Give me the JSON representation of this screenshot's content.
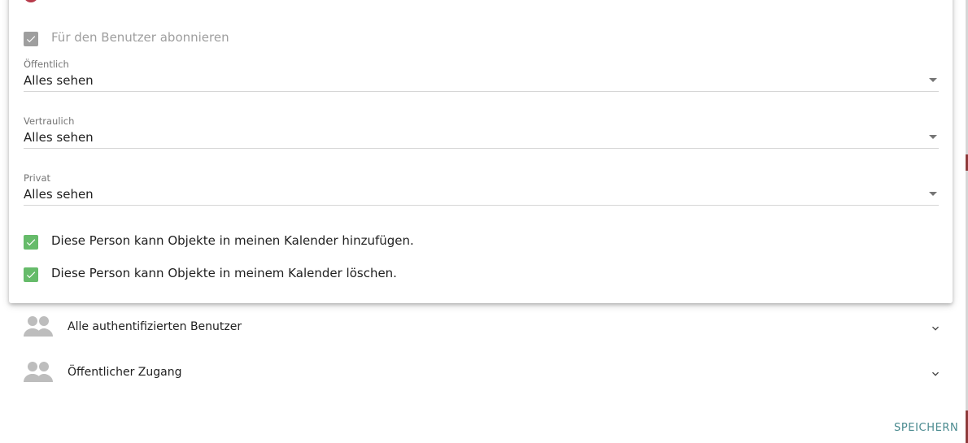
{
  "subscribe": {
    "label": "Für den Benutzer abonnieren",
    "checked": true,
    "disabled": true
  },
  "fields": [
    {
      "label": "Öffentlich",
      "value": "Alles sehen"
    },
    {
      "label": "Vertraulich",
      "value": "Alles sehen"
    },
    {
      "label": "Privat",
      "value": "Alles sehen"
    }
  ],
  "permissions": [
    {
      "label": "Diese Person kann Objekte in meinen Kalender hinzufügen.",
      "checked": true
    },
    {
      "label": "Diese Person kann Objekte in meinem Kalender löschen.",
      "checked": true
    }
  ],
  "groups": [
    {
      "label": "Alle authentifizierten Benutzer",
      "icon": "group-icon"
    },
    {
      "label": "Öffentlicher Zugang",
      "icon": "group-icon"
    }
  ],
  "actions": {
    "save_label": "SPEICHERN"
  },
  "colors": {
    "checkbox_checked": "#66bb6a",
    "checkbox_disabled": "#9e9e9e",
    "save_text": "#4a8a8f",
    "avatar_accent": "#b73a4a"
  }
}
